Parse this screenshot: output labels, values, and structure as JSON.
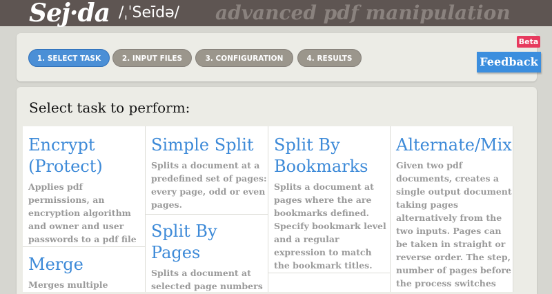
{
  "header": {
    "logo": "Sej·da",
    "phonetic": "/ˌˈSeīdə/",
    "tagline": "advanced pdf manipulation"
  },
  "steps": [
    {
      "label": "1. SELECT TASK",
      "active": true
    },
    {
      "label": "2. INPUT FILES",
      "active": false
    },
    {
      "label": "3. CONFIGURATION",
      "active": false
    },
    {
      "label": "4. RESULTS",
      "active": false
    }
  ],
  "feedback": {
    "label": "Feedback",
    "badge": "Beta"
  },
  "main": {
    "title": "Select task to perform:",
    "tasks": [
      {
        "title": "Encrypt (Protect)",
        "description": "Applies pdf permissions, an encryption algorithm and owner and user passwords to a pdf file"
      },
      {
        "title": "Merge",
        "description": "Merges multiple"
      },
      {
        "title": "Simple Split",
        "description": "Splits a document at a predefined set of pages: every page, odd or even pages."
      },
      {
        "title": "Split By Pages",
        "description": "Splits a document at selected page numbers"
      },
      {
        "title": "Split By Bookmarks",
        "description": "Splits a document at pages where the are bookmarks defined. Specify bookmark level and a regular expression to match the bookmark titles."
      },
      {
        "title": "Alternate/Mix",
        "description": "Given two pdf documents, creates a single output document taking pages alternatively from the two inputs. Pages can be taken in straight or reverse order. The step, number of pages before the process switches"
      }
    ]
  },
  "colors": {
    "header_bg": "#5e5552",
    "accent_blue": "#3d8ad8",
    "step_inactive": "#9b968c",
    "beta_badge": "#e73a5e",
    "description_gray": "#9a9a9a"
  }
}
